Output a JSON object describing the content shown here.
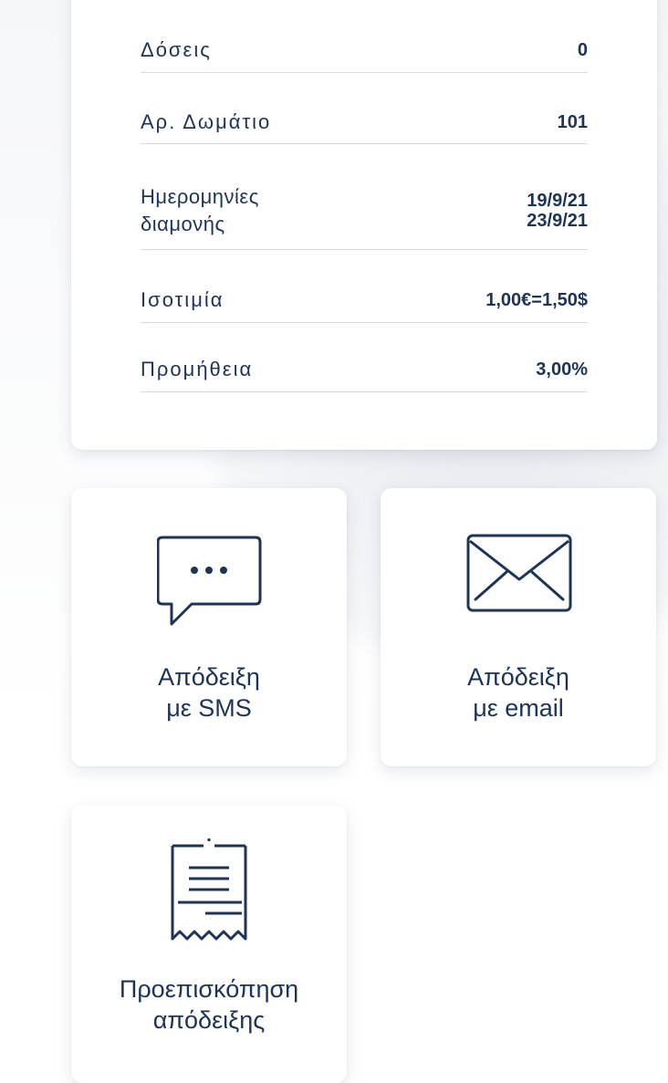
{
  "details": {
    "rows": [
      {
        "label": "Δόσεις",
        "value": "0"
      },
      {
        "label": "Αρ. Δωμάτιο",
        "value": "101"
      },
      {
        "label_line1": "Ημερομηνίες",
        "label_line2": "διαμονής",
        "value_line1": "19/9/21",
        "value_line2": "23/9/21"
      },
      {
        "label": "Ισοτιμία",
        "value": "1,00€=1,50$"
      },
      {
        "label": "Προμήθεια",
        "value": "3,00%"
      }
    ]
  },
  "actions": {
    "sms": {
      "line1": "Απόδειξη",
      "line2": "με SMS",
      "icon": "chat-bubble-icon"
    },
    "email": {
      "line1": "Απόδειξη",
      "line2": "με email",
      "icon": "envelope-icon"
    },
    "preview": {
      "line1": "Προεπισκόπηση",
      "line2": "απόδειξης",
      "icon": "receipt-icon"
    }
  },
  "colors": {
    "text_primary": "#1c3457",
    "divider": "#d6dbe2",
    "card_bg": "#ffffff"
  }
}
